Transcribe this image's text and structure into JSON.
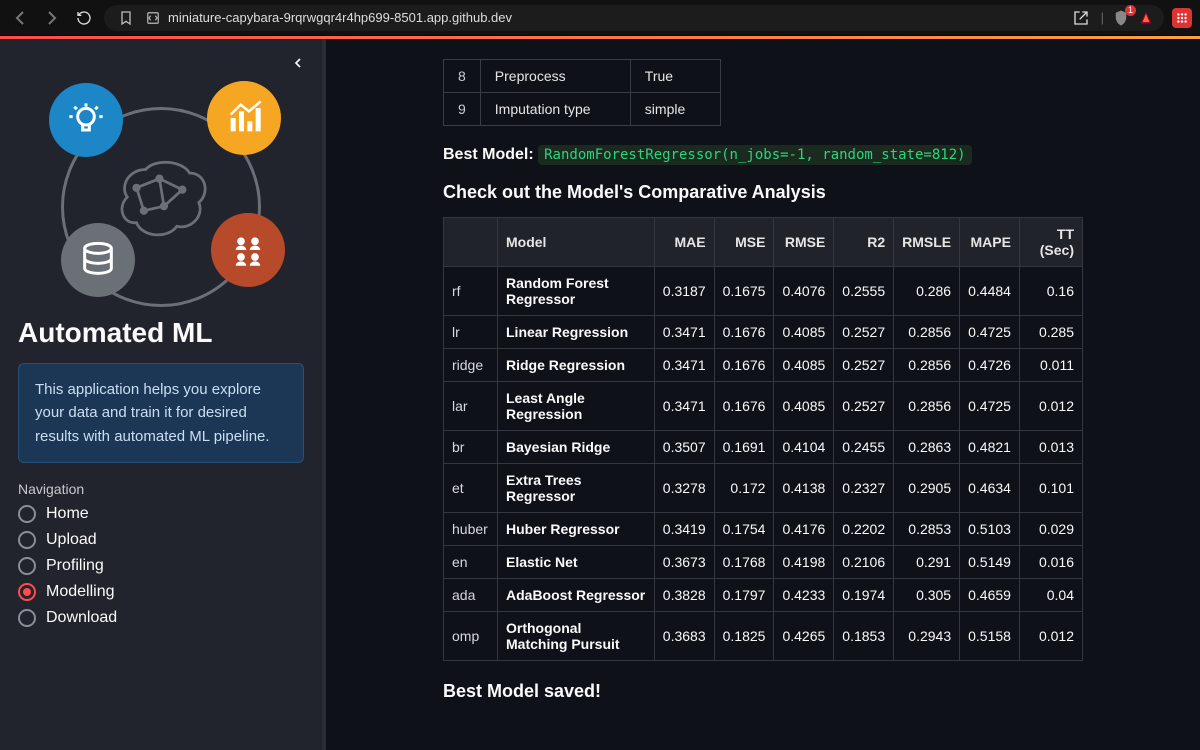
{
  "browser": {
    "url": "miniature-capybara-9rqrwgqr4r4hp699-8501.app.github.dev",
    "shield_count": "1"
  },
  "sidebar": {
    "title": "Automated ML",
    "info": "This application helps you explore your data and train it for desired results with automated ML pipeline.",
    "nav_label": "Navigation",
    "items": [
      {
        "label": "Home"
      },
      {
        "label": "Upload"
      },
      {
        "label": "Profiling"
      },
      {
        "label": "Modelling"
      },
      {
        "label": "Download"
      }
    ],
    "selected_index": 3
  },
  "pre_table": [
    {
      "idx": "8",
      "key": "Preprocess",
      "val": "True"
    },
    {
      "idx": "9",
      "key": "Imputation type",
      "val": "simple"
    }
  ],
  "best_model": {
    "label": "Best Model:",
    "code": "RandomForestRegressor(n_jobs=-1, random_state=812)"
  },
  "analysis_heading": "Check out the Model's Comparative Analysis",
  "model_columns": [
    "",
    "Model",
    "MAE",
    "MSE",
    "RMSE",
    "R2",
    "RMSLE",
    "MAPE",
    "TT (Sec)"
  ],
  "models": [
    {
      "k": "rf",
      "name": "Random Forest Regressor",
      "mae": "0.3187",
      "mse": "0.1675",
      "rmse": "0.4076",
      "r2": "0.2555",
      "rmsle": "0.286",
      "mape": "0.4484",
      "tt": "0.16"
    },
    {
      "k": "lr",
      "name": "Linear Regression",
      "mae": "0.3471",
      "mse": "0.1676",
      "rmse": "0.4085",
      "r2": "0.2527",
      "rmsle": "0.2856",
      "mape": "0.4725",
      "tt": "0.285"
    },
    {
      "k": "ridge",
      "name": "Ridge Regression",
      "mae": "0.3471",
      "mse": "0.1676",
      "rmse": "0.4085",
      "r2": "0.2527",
      "rmsle": "0.2856",
      "mape": "0.4726",
      "tt": "0.011"
    },
    {
      "k": "lar",
      "name": "Least Angle Regression",
      "mae": "0.3471",
      "mse": "0.1676",
      "rmse": "0.4085",
      "r2": "0.2527",
      "rmsle": "0.2856",
      "mape": "0.4725",
      "tt": "0.012"
    },
    {
      "k": "br",
      "name": "Bayesian Ridge",
      "mae": "0.3507",
      "mse": "0.1691",
      "rmse": "0.4104",
      "r2": "0.2455",
      "rmsle": "0.2863",
      "mape": "0.4821",
      "tt": "0.013"
    },
    {
      "k": "et",
      "name": "Extra Trees Regressor",
      "mae": "0.3278",
      "mse": "0.172",
      "rmse": "0.4138",
      "r2": "0.2327",
      "rmsle": "0.2905",
      "mape": "0.4634",
      "tt": "0.101"
    },
    {
      "k": "huber",
      "name": "Huber Regressor",
      "mae": "0.3419",
      "mse": "0.1754",
      "rmse": "0.4176",
      "r2": "0.2202",
      "rmsle": "0.2853",
      "mape": "0.5103",
      "tt": "0.029"
    },
    {
      "k": "en",
      "name": "Elastic Net",
      "mae": "0.3673",
      "mse": "0.1768",
      "rmse": "0.4198",
      "r2": "0.2106",
      "rmsle": "0.291",
      "mape": "0.5149",
      "tt": "0.016"
    },
    {
      "k": "ada",
      "name": "AdaBoost Regressor",
      "mae": "0.3828",
      "mse": "0.1797",
      "rmse": "0.4233",
      "r2": "0.1974",
      "rmsle": "0.305",
      "mape": "0.4659",
      "tt": "0.04"
    },
    {
      "k": "omp",
      "name": "Orthogonal Matching Pursuit",
      "mae": "0.3683",
      "mse": "0.1825",
      "rmse": "0.4265",
      "r2": "0.1853",
      "rmsle": "0.2943",
      "mape": "0.5158",
      "tt": "0.012"
    }
  ],
  "saved_msg": "Best Model saved!"
}
